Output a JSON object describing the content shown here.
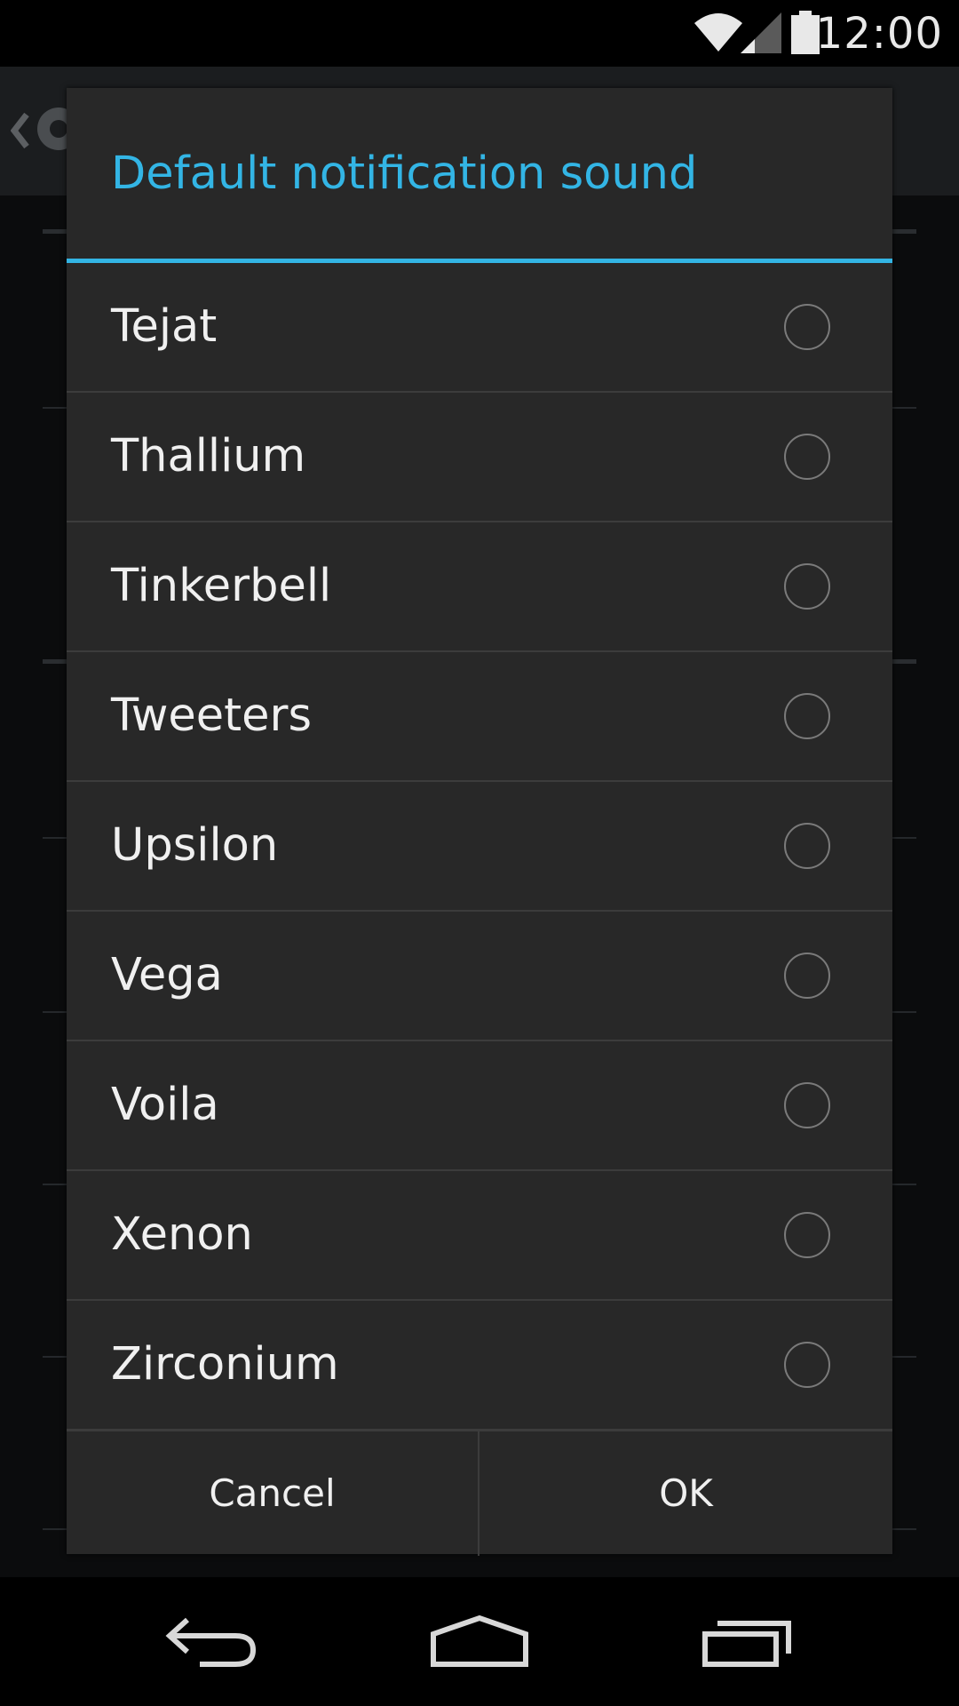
{
  "status_bar": {
    "time": "12:00",
    "icons": [
      "wifi-icon",
      "signal-icon",
      "battery-icon"
    ]
  },
  "dialog": {
    "title": "Default notification sound",
    "items": [
      {
        "label": "Tejat",
        "selected": false
      },
      {
        "label": "Thallium",
        "selected": false
      },
      {
        "label": "Tinkerbell",
        "selected": false
      },
      {
        "label": "Tweeters",
        "selected": false
      },
      {
        "label": "Upsilon",
        "selected": false
      },
      {
        "label": "Vega",
        "selected": false
      },
      {
        "label": "Voila",
        "selected": false
      },
      {
        "label": "Xenon",
        "selected": false
      },
      {
        "label": "Zirconium",
        "selected": false
      }
    ],
    "cancel_label": "Cancel",
    "ok_label": "OK"
  },
  "nav_bar": {
    "icons": [
      "back-icon",
      "home-icon",
      "recents-icon"
    ]
  },
  "colors": {
    "accent": "#33b5e5",
    "dialog_background": "#282828",
    "text": "#f0f0f0"
  }
}
